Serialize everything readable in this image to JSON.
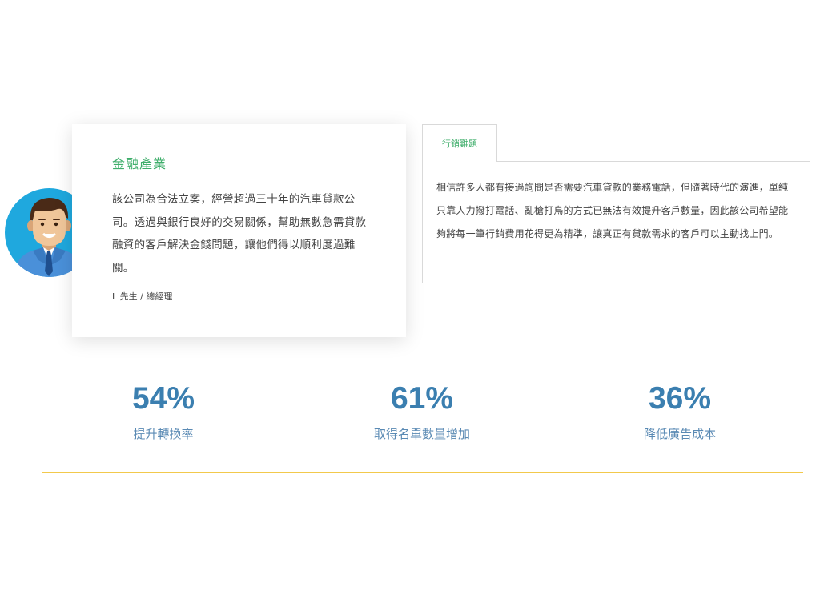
{
  "case": {
    "industry": "金融產業",
    "description": "該公司為合法立案，經營超過三十年的汽車貸款公司。透過與銀行良好的交易關係，幫助無數急需貸款融資的客戶解決金錢問題，讓他們得以順利度過難關。",
    "client": "L 先生 / 總經理"
  },
  "tabs": {
    "active_label": "行銷難題",
    "content": "相信許多人都有接過詢問是否需要汽車貸款的業務電話，但隨著時代的演進，單純只靠人力撥打電話、亂槍打鳥的方式已無法有效提升客戶數量，因此該公司希望能夠將每一筆行銷費用花得更為精準，讓真正有貸款需求的客戶可以主動找上門。"
  },
  "stats": [
    {
      "value": "54%",
      "label": "提升轉換率"
    },
    {
      "value": "61%",
      "label": "取得名單數量增加"
    },
    {
      "value": "36%",
      "label": "降低廣告成本"
    }
  ],
  "colors": {
    "accent_green": "#3fae6b",
    "stat_blue": "#3b7fb0",
    "divider_yellow": "#f2c94c",
    "avatar_bg": "#1fa8de"
  },
  "icons": {
    "avatar": "businessman-avatar-icon"
  }
}
